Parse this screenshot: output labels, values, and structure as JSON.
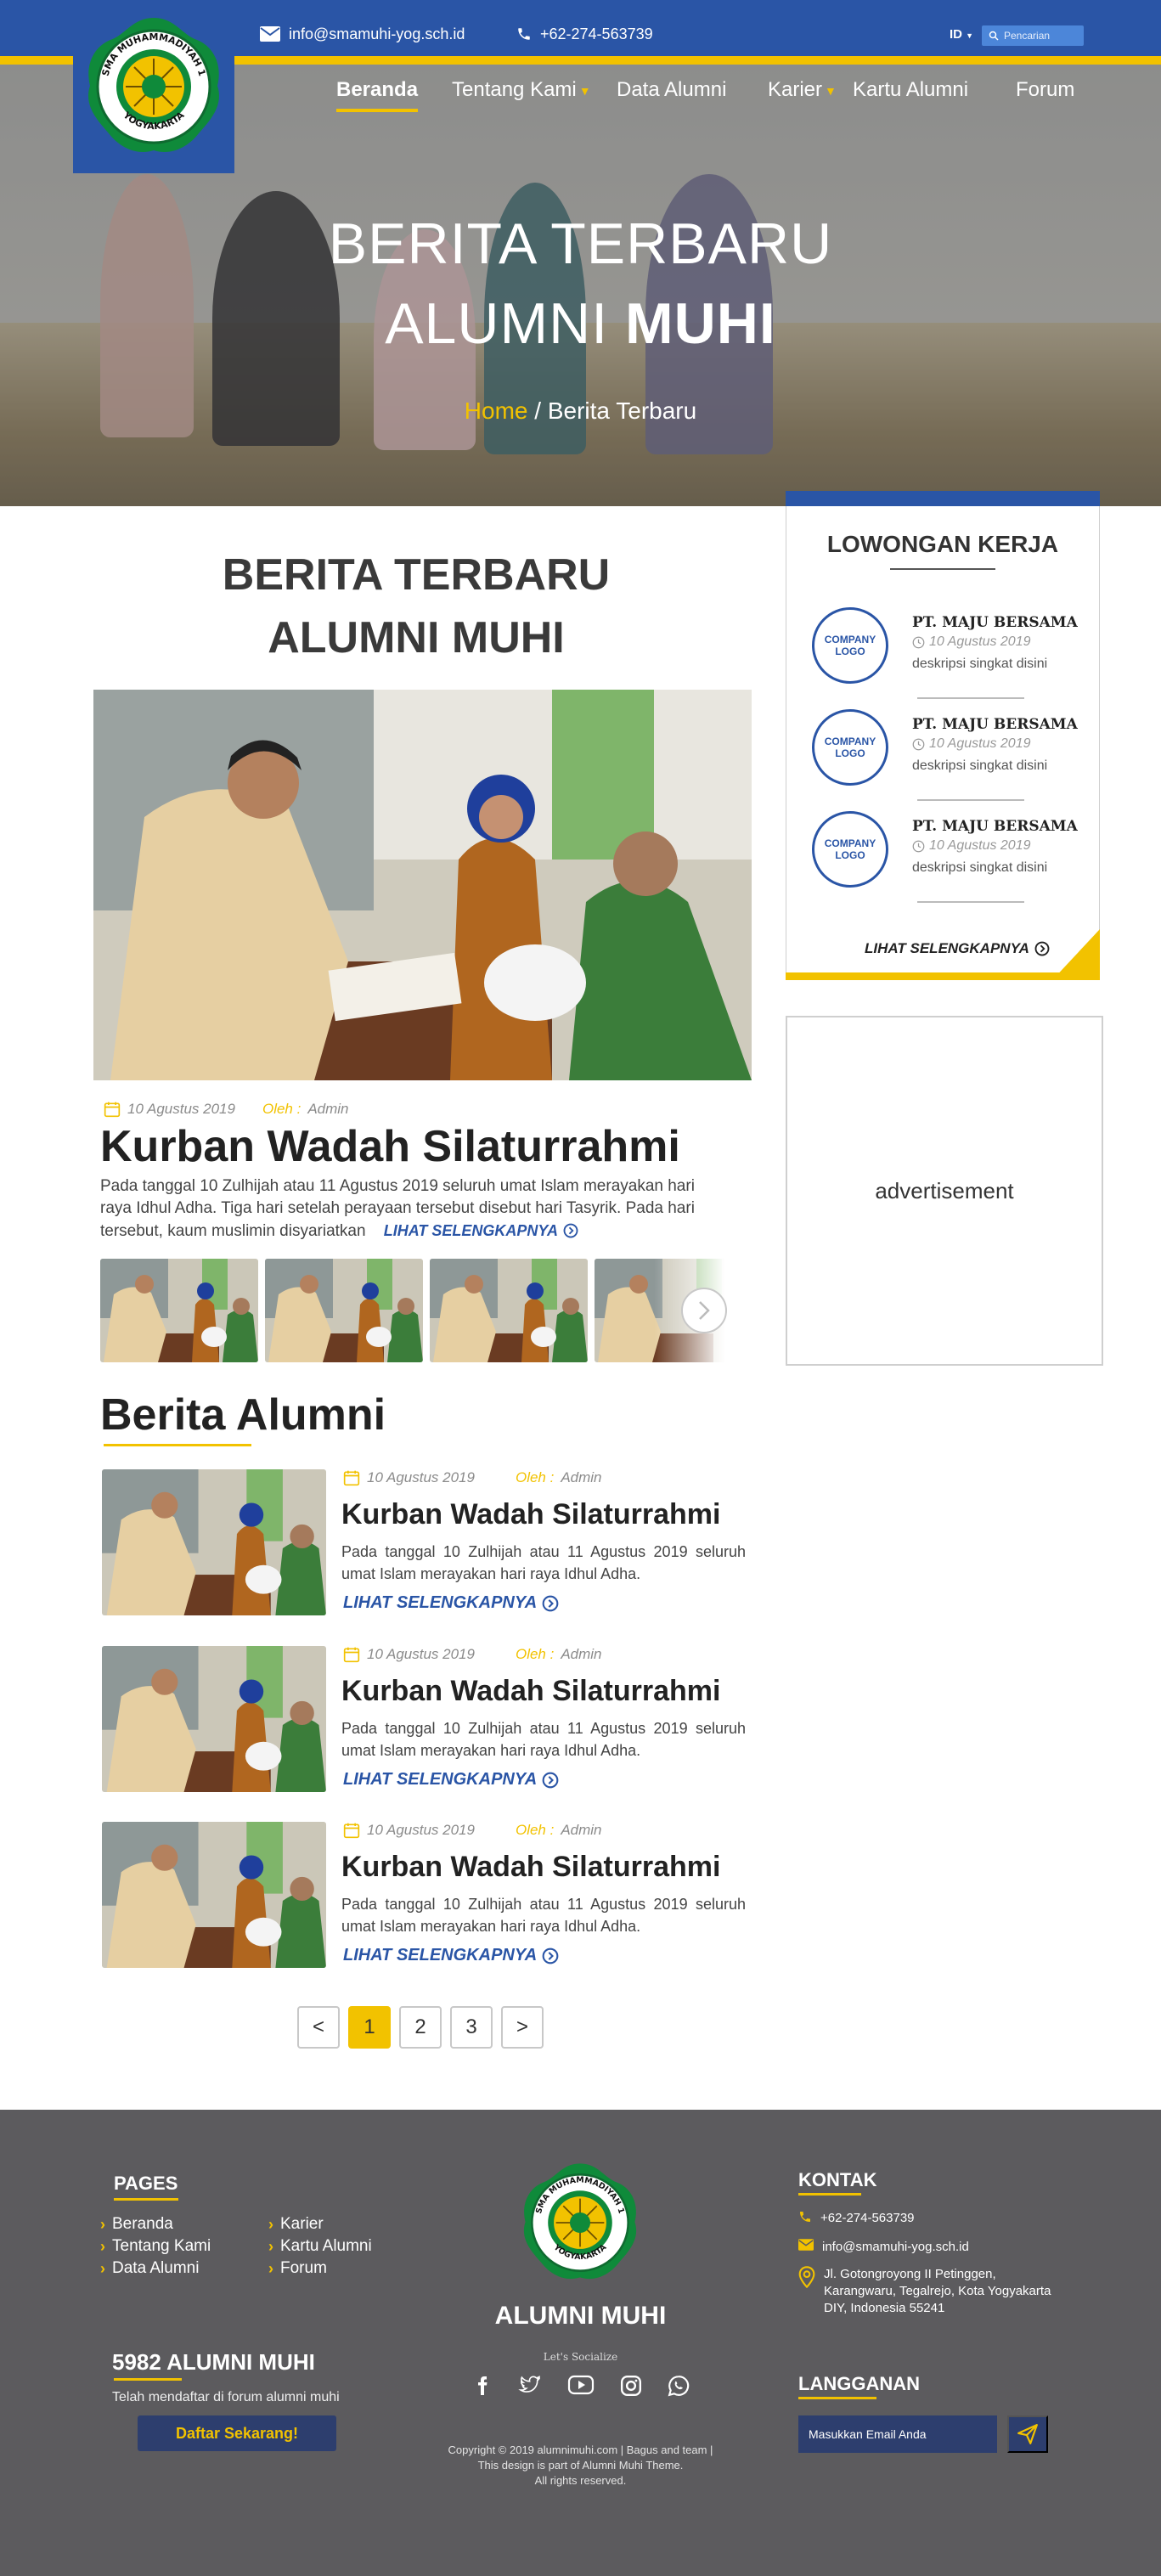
{
  "topbar": {
    "email": "info@smamuhi-yog.sch.id",
    "phone": "+62-274-563739",
    "language": "ID",
    "search_placeholder": "Pencarian"
  },
  "logo": {
    "ring_top": "SMA MUHAMMADIYAH 1",
    "ring_bottom": "YOGYAKARTA"
  },
  "nav": {
    "items": [
      {
        "label": "Beranda",
        "active": true
      },
      {
        "label": "Tentang Kami",
        "dropdown": true
      },
      {
        "label": "Data Alumni"
      },
      {
        "label": "Karier",
        "dropdown": true
      },
      {
        "label": "Kartu Alumni"
      },
      {
        "label": "Forum"
      }
    ]
  },
  "hero": {
    "title_line1": "BERITA TERBARU",
    "title_line2_light": "ALUMNI",
    "title_line2_bold": "MUHI",
    "breadcrumb_home": "Home",
    "breadcrumb_sep": " / ",
    "breadcrumb_current": "Berita Terbaru"
  },
  "main": {
    "title_line1": "BERITA TERBARU",
    "title_line2_light": "ALUMNI",
    "title_line2_bold": "MUHI",
    "featured": {
      "date": "10 Agustus 2019",
      "by_label": "Oleh :",
      "author": "Admin",
      "title": "Kurban Wadah Silaturrahmi",
      "body": "Pada tanggal 10 Zulhijah atau 11 Agustus 2019 seluruh umat Islam merayakan hari raya Idhul Adha. Tiga hari setelah perayaan tersebut disebut hari Tasyrik. Pada hari tersebut, kaum muslimin disyariatkan",
      "more": "LIHAT SELENGKAPNYA"
    },
    "section_title": "Berita Alumni",
    "news": [
      {
        "date": "10 Agustus 2019",
        "by_label": "Oleh :",
        "author": "Admin",
        "title": "Kurban Wadah Silaturrahmi",
        "body": "Pada tanggal 10 Zulhijah atau 11 Agustus 2019 seluruh umat Islam merayakan hari raya Idhul Adha.",
        "more": "LIHAT SELENGKAPNYA"
      },
      {
        "date": "10 Agustus 2019",
        "by_label": "Oleh :",
        "author": "Admin",
        "title": "Kurban Wadah Silaturrahmi",
        "body": "Pada tanggal 10 Zulhijah atau 11 Agustus 2019 seluruh umat Islam merayakan hari raya Idhul Adha.",
        "more": "LIHAT SELENGKAPNYA"
      },
      {
        "date": "10 Agustus 2019",
        "by_label": "Oleh :",
        "author": "Admin",
        "title": "Kurban Wadah Silaturrahmi",
        "body": "Pada tanggal 10 Zulhijah atau 11 Agustus 2019 seluruh umat Islam merayakan hari raya Idhul Adha.",
        "more": "LIHAT SELENGKAPNYA"
      }
    ],
    "pagination": {
      "prev": "<",
      "pages": [
        "1",
        "2",
        "3"
      ],
      "current": "1",
      "next": ">"
    }
  },
  "sidebar": {
    "jobs_title": "LOWONGAN KERJA",
    "jobs": [
      {
        "logo_text": "COMPANY LOGO",
        "company": "PT. MAJU BERSAMA",
        "date": "10 Agustus 2019",
        "desc": "deskripsi singkat disini"
      },
      {
        "logo_text": "COMPANY LOGO",
        "company": "PT. MAJU BERSAMA",
        "date": "10 Agustus 2019",
        "desc": "deskripsi singkat disini"
      },
      {
        "logo_text": "COMPANY LOGO",
        "company": "PT. MAJU BERSAMA",
        "date": "10 Agustus 2019",
        "desc": "deskripsi singkat disini"
      }
    ],
    "jobs_more": "LIHAT SELENGKAPNYA",
    "ad_label": "advertisement"
  },
  "footer": {
    "pages_title": "PAGES",
    "pages_col1": [
      "Beranda",
      "Tentang Kami",
      "Data Alumni"
    ],
    "pages_col2": [
      "Karier",
      "Kartu Alumni",
      "Forum"
    ],
    "count_title": "5982 ALUMNI MUHI",
    "count_sub": "Telah mendaftar di forum alumni muhi",
    "register_button": "Daftar Sekarang!",
    "brand": "ALUMNI MUHI",
    "social_label": "Let's Socialize",
    "socials": [
      "facebook-icon",
      "twitter-icon",
      "youtube-icon",
      "instagram-icon",
      "whatsapp-icon"
    ],
    "copyright_line1": "Copyright © 2019 alumnimuhi.com | Bagus and team |",
    "copyright_line2": "This design is part of Alumni Muhi Theme.",
    "copyright_line3": "All rights reserved.",
    "contact_title": "KONTAK",
    "contact_phone": "+62-274-563739",
    "contact_email": "info@smamuhi-yog.sch.id",
    "contact_address": "Jl. Gotongroyong II Petinggen, Karangwaru, Tegalrejo, Kota Yogyakarta DIY, Indonesia 55241",
    "subscribe_title": "LANGGANAN",
    "subscribe_placeholder": "Masukkan Email Anda"
  },
  "colors": {
    "primary_blue": "#2a55a6",
    "accent_yellow": "#f2c200",
    "footer_bg": "#5c5b5e",
    "footer_button": "#2d3e6e"
  }
}
